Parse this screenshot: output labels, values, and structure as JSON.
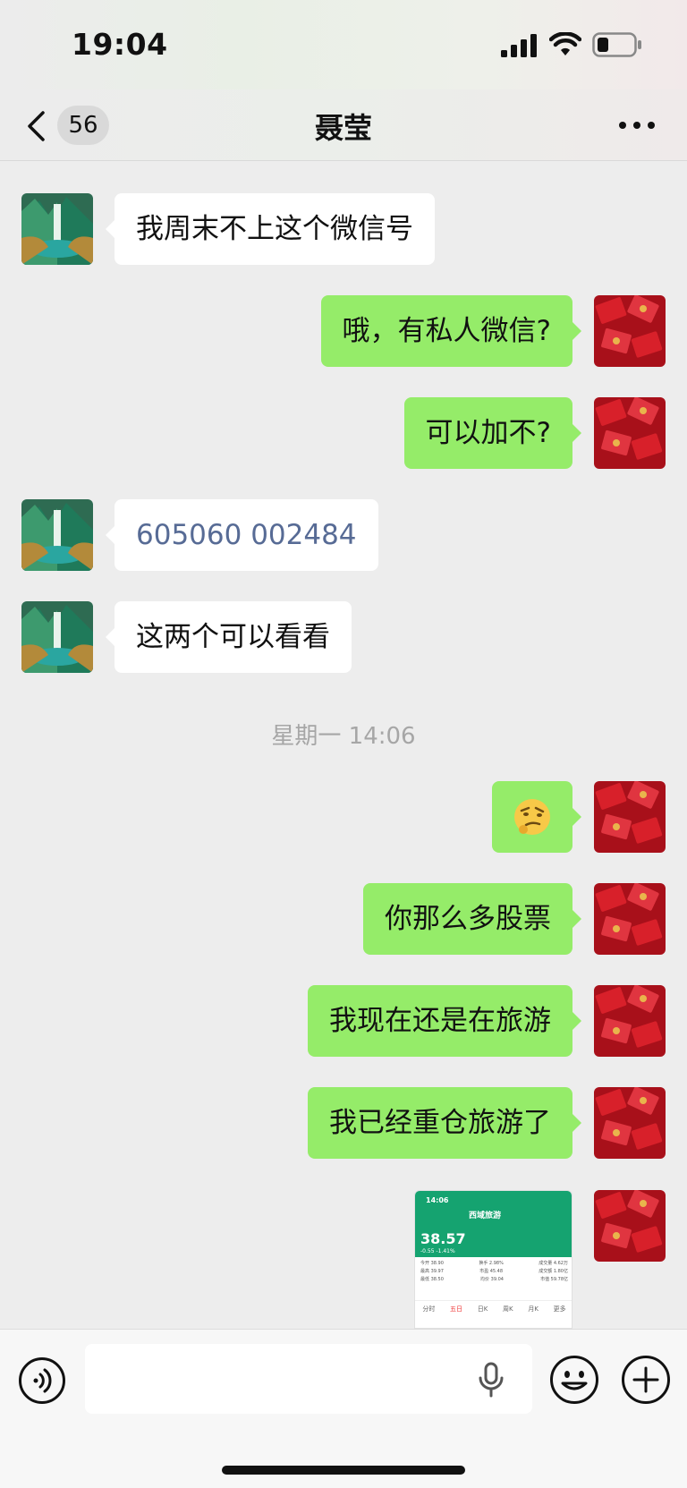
{
  "status_bar": {
    "time": "19:04"
  },
  "nav": {
    "unread_count": "56",
    "title": "聂莹"
  },
  "messages": [
    {
      "side": "in",
      "text": "我周末不上这个微信号"
    },
    {
      "side": "out",
      "text": "哦，有私人微信?"
    },
    {
      "side": "out",
      "text": "可以加不?"
    },
    {
      "side": "in",
      "text": "605060 002484"
    },
    {
      "side": "in",
      "text": "这两个可以看看"
    },
    {
      "side": "out",
      "emoji": "🤨"
    },
    {
      "side": "out",
      "text": "你那么多股票"
    },
    {
      "side": "out",
      "text": "我现在还是在旅游"
    },
    {
      "side": "out",
      "text": "我已经重仓旅游了"
    }
  ],
  "timestamp": "星期一 14:06",
  "shared_screenshot": {
    "time": "14:06",
    "stock_name": "西域旅游",
    "price": "38.57",
    "change": "-0.55  -1.41%",
    "rows": [
      [
        "今开 38.90",
        "换手 2.98%",
        "成交量 4.62万"
      ],
      [
        "最高 39.97",
        "市盈 45.48",
        "成交额 1.80亿"
      ],
      [
        "最低 38.50",
        "均价 39.04",
        "市值 59.78亿"
      ]
    ],
    "tabs": [
      "分时",
      "五日",
      "日K",
      "周K",
      "月K",
      "更多"
    ]
  },
  "colors": {
    "outgoing_bubble": "#95ec69",
    "incoming_bubble": "#ffffff",
    "link": "#576b95",
    "background": "#ededed"
  },
  "input": {
    "placeholder": ""
  }
}
